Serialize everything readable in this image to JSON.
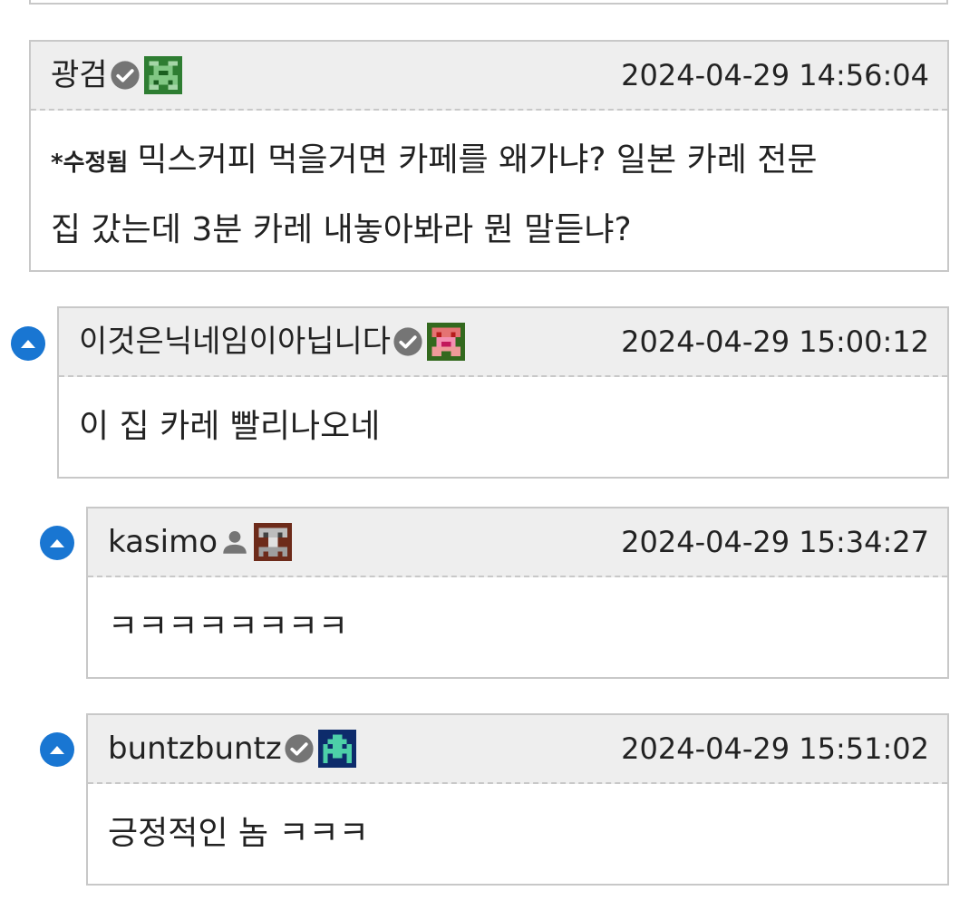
{
  "comments": [
    {
      "author": "광검",
      "badge": "verified-check-icon",
      "level_icon": "green-pixel-avatar-icon",
      "timestamp": "2024-04-29 14:56:04",
      "edited_label": "*수정됨",
      "body_line1": "믹스커피 먹을거면 카페를 왜가냐? 일본 카레 전문",
      "body_line2": "집 갔는데 3분 카레 내놓아봐라 뭔 말듣냐?"
    },
    {
      "author": "이것은닉네임이아닙니다",
      "badge": "verified-check-icon",
      "level_icon": "pink-pixel-avatar-icon",
      "timestamp": "2024-04-29 15:00:12",
      "body": "이 집 카레 빨리나오네"
    },
    {
      "author": "kasimo",
      "badge": "person-icon",
      "level_icon": "brown-pixel-avatar-icon",
      "timestamp": "2024-04-29 15:34:27",
      "body": "ㅋㅋㅋㅋㅋㅋㅋㅋ"
    },
    {
      "author": "buntzbuntz",
      "badge": "verified-check-icon",
      "level_icon": "teal-pixel-invader-icon",
      "timestamp": "2024-04-29 15:51:02",
      "body": "긍정적인 놈 ㅋㅋㅋ"
    }
  ],
  "colors": {
    "accent": "#1976d2",
    "header_bg": "#eeeeee",
    "border": "#c8c8c8",
    "badge_gray": "#757575"
  }
}
